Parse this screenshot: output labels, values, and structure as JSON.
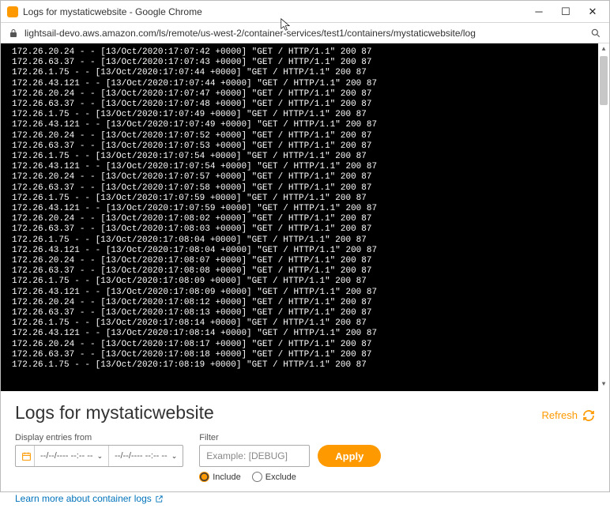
{
  "window": {
    "title": "Logs for mystaticwebsite - Google Chrome"
  },
  "browser": {
    "url": "lightsail-devo.aws.amazon.com/ls/remote/us-west-2/container-services/test1/containers/mystaticwebsite/log"
  },
  "logs": [
    "172.26.20.24 - - [13/Oct/2020:17:07:42 +0000] \"GET / HTTP/1.1\" 200 87",
    "172.26.63.37 - - [13/Oct/2020:17:07:43 +0000] \"GET / HTTP/1.1\" 200 87",
    "172.26.1.75 - - [13/Oct/2020:17:07:44 +0000] \"GET / HTTP/1.1\" 200 87",
    "172.26.43.121 - - [13/Oct/2020:17:07:44 +0000] \"GET / HTTP/1.1\" 200 87",
    "172.26.20.24 - - [13/Oct/2020:17:07:47 +0000] \"GET / HTTP/1.1\" 200 87",
    "172.26.63.37 - - [13/Oct/2020:17:07:48 +0000] \"GET / HTTP/1.1\" 200 87",
    "172.26.1.75 - - [13/Oct/2020:17:07:49 +0000] \"GET / HTTP/1.1\" 200 87",
    "172.26.43.121 - - [13/Oct/2020:17:07:49 +0000] \"GET / HTTP/1.1\" 200 87",
    "172.26.20.24 - - [13/Oct/2020:17:07:52 +0000] \"GET / HTTP/1.1\" 200 87",
    "172.26.63.37 - - [13/Oct/2020:17:07:53 +0000] \"GET / HTTP/1.1\" 200 87",
    "172.26.1.75 - - [13/Oct/2020:17:07:54 +0000] \"GET / HTTP/1.1\" 200 87",
    "172.26.43.121 - - [13/Oct/2020:17:07:54 +0000] \"GET / HTTP/1.1\" 200 87",
    "172.26.20.24 - - [13/Oct/2020:17:07:57 +0000] \"GET / HTTP/1.1\" 200 87",
    "172.26.63.37 - - [13/Oct/2020:17:07:58 +0000] \"GET / HTTP/1.1\" 200 87",
    "172.26.1.75 - - [13/Oct/2020:17:07:59 +0000] \"GET / HTTP/1.1\" 200 87",
    "172.26.43.121 - - [13/Oct/2020:17:07:59 +0000] \"GET / HTTP/1.1\" 200 87",
    "172.26.20.24 - - [13/Oct/2020:17:08:02 +0000] \"GET / HTTP/1.1\" 200 87",
    "172.26.63.37 - - [13/Oct/2020:17:08:03 +0000] \"GET / HTTP/1.1\" 200 87",
    "172.26.1.75 - - [13/Oct/2020:17:08:04 +0000] \"GET / HTTP/1.1\" 200 87",
    "172.26.43.121 - - [13/Oct/2020:17:08:04 +0000] \"GET / HTTP/1.1\" 200 87",
    "172.26.20.24 - - [13/Oct/2020:17:08:07 +0000] \"GET / HTTP/1.1\" 200 87",
    "172.26.63.37 - - [13/Oct/2020:17:08:08 +0000] \"GET / HTTP/1.1\" 200 87",
    "172.26.1.75 - - [13/Oct/2020:17:08:09 +0000] \"GET / HTTP/1.1\" 200 87",
    "172.26.43.121 - - [13/Oct/2020:17:08:09 +0000] \"GET / HTTP/1.1\" 200 87",
    "172.26.20.24 - - [13/Oct/2020:17:08:12 +0000] \"GET / HTTP/1.1\" 200 87",
    "172.26.63.37 - - [13/Oct/2020:17:08:13 +0000] \"GET / HTTP/1.1\" 200 87",
    "172.26.1.75 - - [13/Oct/2020:17:08:14 +0000] \"GET / HTTP/1.1\" 200 87",
    "172.26.43.121 - - [13/Oct/2020:17:08:14 +0000] \"GET / HTTP/1.1\" 200 87",
    "172.26.20.24 - - [13/Oct/2020:17:08:17 +0000] \"GET / HTTP/1.1\" 200 87",
    "172.26.63.37 - - [13/Oct/2020:17:08:18 +0000] \"GET / HTTP/1.1\" 200 87",
    "172.26.1.75 - - [13/Oct/2020:17:08:19 +0000] \"GET / HTTP/1.1\" 200 87"
  ],
  "panel": {
    "title": "Logs for mystaticwebsite",
    "refresh": "Refresh",
    "display_label": "Display entries from",
    "date_from": "--/--/---- --:--  --",
    "date_to": "--/--/---- --:--  --",
    "filter_label": "Filter",
    "filter_placeholder": "Example: [DEBUG]",
    "apply": "Apply",
    "include": "Include",
    "exclude": "Exclude",
    "learn": "Learn more about container logs"
  }
}
